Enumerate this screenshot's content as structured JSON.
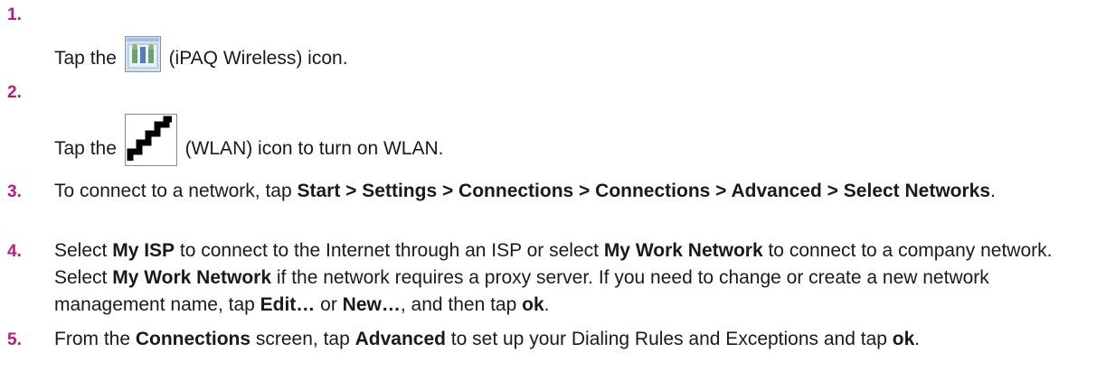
{
  "steps": [
    {
      "number": "1.",
      "prefix": "Tap the ",
      "icon": "ipaq-wireless-icon",
      "suffix": " (iPAQ Wireless) icon."
    },
    {
      "number": "2.",
      "prefix": "Tap the ",
      "icon": "wlan-icon",
      "suffix": " (WLAN) icon to turn on WLAN."
    },
    {
      "number": "3.",
      "t1": "To connect to a network, tap ",
      "b1": "Start > Settings > Connections > Connections > Advanced >",
      "t2": " ",
      "b2": "Select Networks",
      "t3": "."
    },
    {
      "number": "4.",
      "t1": "Select ",
      "b1": "My ISP",
      "t2": " to connect to the Internet through an ISP or select ",
      "b2": "My Work Network",
      "t3": " to connect to a company network. Select ",
      "b3": "My Work Network",
      "t4": " if the network requires a proxy server. If you need to change or create a new network management name, tap ",
      "b4": "Edit…",
      "t5": " or ",
      "b5": "New…",
      "t6": ", and then tap ",
      "b6": "ok",
      "t7": "."
    },
    {
      "number": "5.",
      "t1": "From the ",
      "b1": "Connections",
      "t2": " screen, tap ",
      "b2": "Advanced",
      "t3": " to set up your Dialing Rules and Exceptions and tap ",
      "b3": "ok",
      "t4": "."
    }
  ]
}
